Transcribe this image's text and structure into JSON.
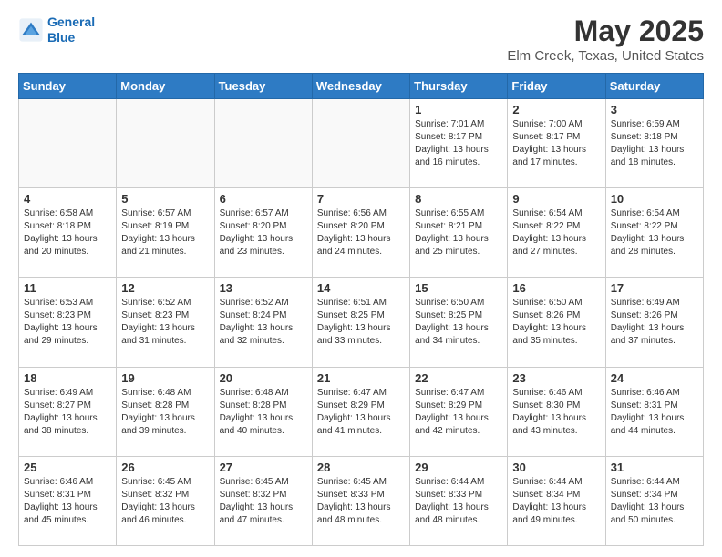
{
  "header": {
    "logo_line1": "General",
    "logo_line2": "Blue",
    "title": "May 2025",
    "subtitle": "Elm Creek, Texas, United States"
  },
  "days_of_week": [
    "Sunday",
    "Monday",
    "Tuesday",
    "Wednesday",
    "Thursday",
    "Friday",
    "Saturday"
  ],
  "weeks": [
    [
      {
        "day": "",
        "info": ""
      },
      {
        "day": "",
        "info": ""
      },
      {
        "day": "",
        "info": ""
      },
      {
        "day": "",
        "info": ""
      },
      {
        "day": "1",
        "info": "Sunrise: 7:01 AM\nSunset: 8:17 PM\nDaylight: 13 hours\nand 16 minutes."
      },
      {
        "day": "2",
        "info": "Sunrise: 7:00 AM\nSunset: 8:17 PM\nDaylight: 13 hours\nand 17 minutes."
      },
      {
        "day": "3",
        "info": "Sunrise: 6:59 AM\nSunset: 8:18 PM\nDaylight: 13 hours\nand 18 minutes."
      }
    ],
    [
      {
        "day": "4",
        "info": "Sunrise: 6:58 AM\nSunset: 8:18 PM\nDaylight: 13 hours\nand 20 minutes."
      },
      {
        "day": "5",
        "info": "Sunrise: 6:57 AM\nSunset: 8:19 PM\nDaylight: 13 hours\nand 21 minutes."
      },
      {
        "day": "6",
        "info": "Sunrise: 6:57 AM\nSunset: 8:20 PM\nDaylight: 13 hours\nand 23 minutes."
      },
      {
        "day": "7",
        "info": "Sunrise: 6:56 AM\nSunset: 8:20 PM\nDaylight: 13 hours\nand 24 minutes."
      },
      {
        "day": "8",
        "info": "Sunrise: 6:55 AM\nSunset: 8:21 PM\nDaylight: 13 hours\nand 25 minutes."
      },
      {
        "day": "9",
        "info": "Sunrise: 6:54 AM\nSunset: 8:22 PM\nDaylight: 13 hours\nand 27 minutes."
      },
      {
        "day": "10",
        "info": "Sunrise: 6:54 AM\nSunset: 8:22 PM\nDaylight: 13 hours\nand 28 minutes."
      }
    ],
    [
      {
        "day": "11",
        "info": "Sunrise: 6:53 AM\nSunset: 8:23 PM\nDaylight: 13 hours\nand 29 minutes."
      },
      {
        "day": "12",
        "info": "Sunrise: 6:52 AM\nSunset: 8:23 PM\nDaylight: 13 hours\nand 31 minutes."
      },
      {
        "day": "13",
        "info": "Sunrise: 6:52 AM\nSunset: 8:24 PM\nDaylight: 13 hours\nand 32 minutes."
      },
      {
        "day": "14",
        "info": "Sunrise: 6:51 AM\nSunset: 8:25 PM\nDaylight: 13 hours\nand 33 minutes."
      },
      {
        "day": "15",
        "info": "Sunrise: 6:50 AM\nSunset: 8:25 PM\nDaylight: 13 hours\nand 34 minutes."
      },
      {
        "day": "16",
        "info": "Sunrise: 6:50 AM\nSunset: 8:26 PM\nDaylight: 13 hours\nand 35 minutes."
      },
      {
        "day": "17",
        "info": "Sunrise: 6:49 AM\nSunset: 8:26 PM\nDaylight: 13 hours\nand 37 minutes."
      }
    ],
    [
      {
        "day": "18",
        "info": "Sunrise: 6:49 AM\nSunset: 8:27 PM\nDaylight: 13 hours\nand 38 minutes."
      },
      {
        "day": "19",
        "info": "Sunrise: 6:48 AM\nSunset: 8:28 PM\nDaylight: 13 hours\nand 39 minutes."
      },
      {
        "day": "20",
        "info": "Sunrise: 6:48 AM\nSunset: 8:28 PM\nDaylight: 13 hours\nand 40 minutes."
      },
      {
        "day": "21",
        "info": "Sunrise: 6:47 AM\nSunset: 8:29 PM\nDaylight: 13 hours\nand 41 minutes."
      },
      {
        "day": "22",
        "info": "Sunrise: 6:47 AM\nSunset: 8:29 PM\nDaylight: 13 hours\nand 42 minutes."
      },
      {
        "day": "23",
        "info": "Sunrise: 6:46 AM\nSunset: 8:30 PM\nDaylight: 13 hours\nand 43 minutes."
      },
      {
        "day": "24",
        "info": "Sunrise: 6:46 AM\nSunset: 8:31 PM\nDaylight: 13 hours\nand 44 minutes."
      }
    ],
    [
      {
        "day": "25",
        "info": "Sunrise: 6:46 AM\nSunset: 8:31 PM\nDaylight: 13 hours\nand 45 minutes."
      },
      {
        "day": "26",
        "info": "Sunrise: 6:45 AM\nSunset: 8:32 PM\nDaylight: 13 hours\nand 46 minutes."
      },
      {
        "day": "27",
        "info": "Sunrise: 6:45 AM\nSunset: 8:32 PM\nDaylight: 13 hours\nand 47 minutes."
      },
      {
        "day": "28",
        "info": "Sunrise: 6:45 AM\nSunset: 8:33 PM\nDaylight: 13 hours\nand 48 minutes."
      },
      {
        "day": "29",
        "info": "Sunrise: 6:44 AM\nSunset: 8:33 PM\nDaylight: 13 hours\nand 48 minutes."
      },
      {
        "day": "30",
        "info": "Sunrise: 6:44 AM\nSunset: 8:34 PM\nDaylight: 13 hours\nand 49 minutes."
      },
      {
        "day": "31",
        "info": "Sunrise: 6:44 AM\nSunset: 8:34 PM\nDaylight: 13 hours\nand 50 minutes."
      }
    ]
  ]
}
